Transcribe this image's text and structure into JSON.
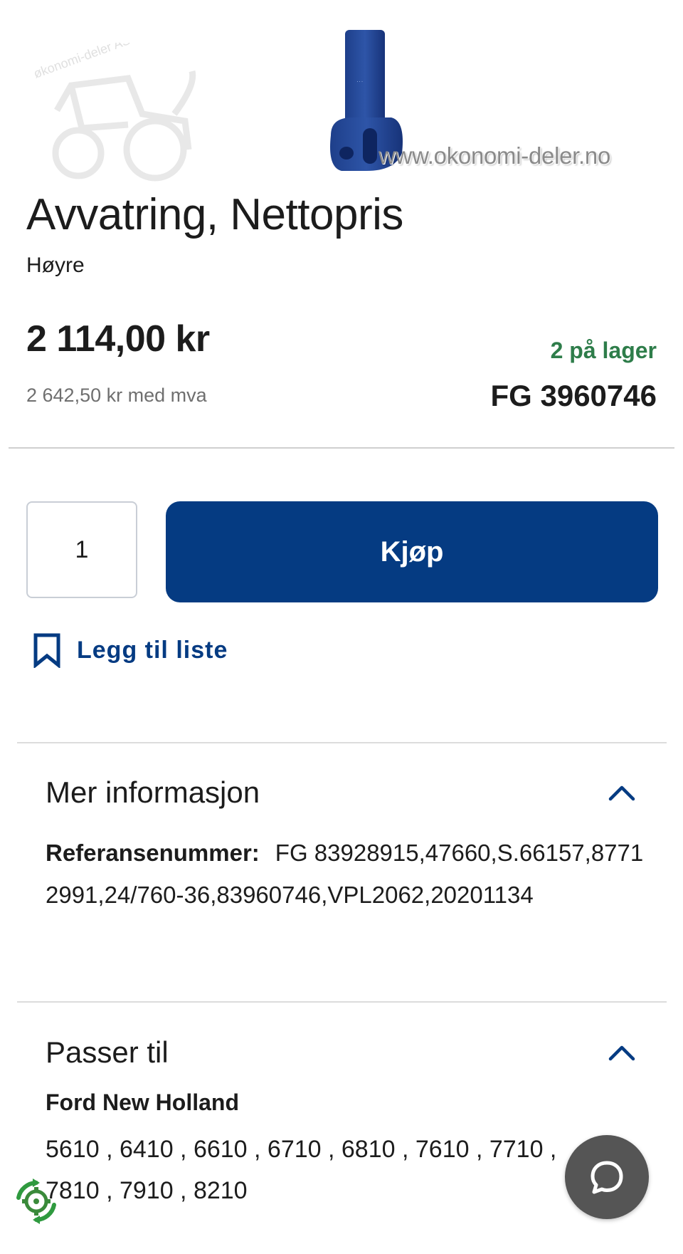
{
  "product_image": {
    "watermark_url": "www.okonomi-deler.no",
    "watermark_logo_text": "økonomi-deler AS"
  },
  "product": {
    "title": "Avvatring, Nettopris",
    "subtitle": "Høyre",
    "price": "2 114,00 kr",
    "price_vat": "2 642,50 kr med mva",
    "stock": "2 på lager",
    "sku": "FG 3960746"
  },
  "purchase": {
    "quantity": "1",
    "buy_label": "Kjøp",
    "add_to_list_label": "Legg til liste"
  },
  "more_info": {
    "title": "Mer informasjon",
    "reference_label": "Referansenummer:",
    "reference_value": "FG 83928915,47660,S.66157,87712991,24/760-36,83960746,VPL2062,20201134"
  },
  "fits": {
    "title": "Passer til",
    "brand": "Ford New Holland",
    "models": "5610 , 6410 , 6610 , 6710 , 6810 , 7610 , 7710 , 7810 , 7910 , 8210"
  },
  "colors": {
    "brand_blue": "#053b82",
    "stock_green": "#2e7d4a",
    "chat_gray": "#555555"
  },
  "icons": {
    "bookmark": "bookmark-icon",
    "chevron": "chevron-up-icon",
    "chat": "chat-bubble-icon",
    "eco": "recycle-gear-icon"
  }
}
